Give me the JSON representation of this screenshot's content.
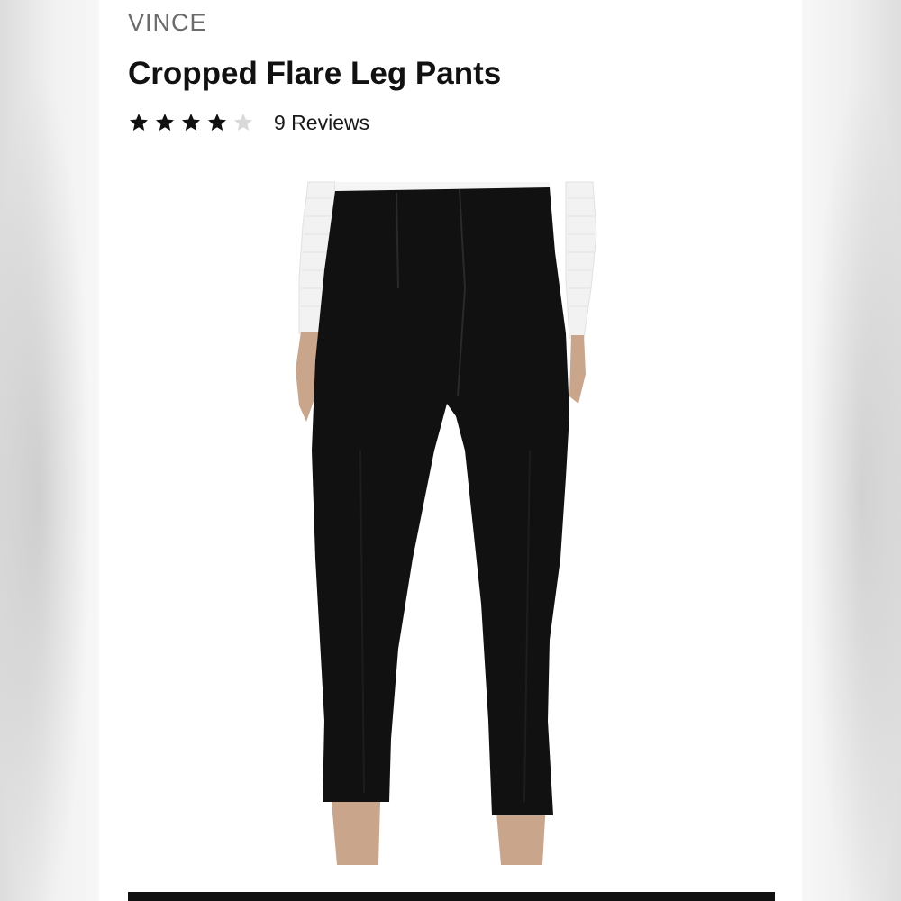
{
  "product": {
    "brand": "VINCE",
    "title": "Cropped Flare Leg Pants",
    "rating": {
      "value": 4,
      "max": 5,
      "reviews_label": "9 Reviews",
      "filled_color": "#111111",
      "empty_color": "#d9d9d9"
    },
    "image": {
      "alt": "Cropped Flare Leg Pants",
      "garment_color": "#111111",
      "top_color": "#f2f2f2"
    }
  }
}
